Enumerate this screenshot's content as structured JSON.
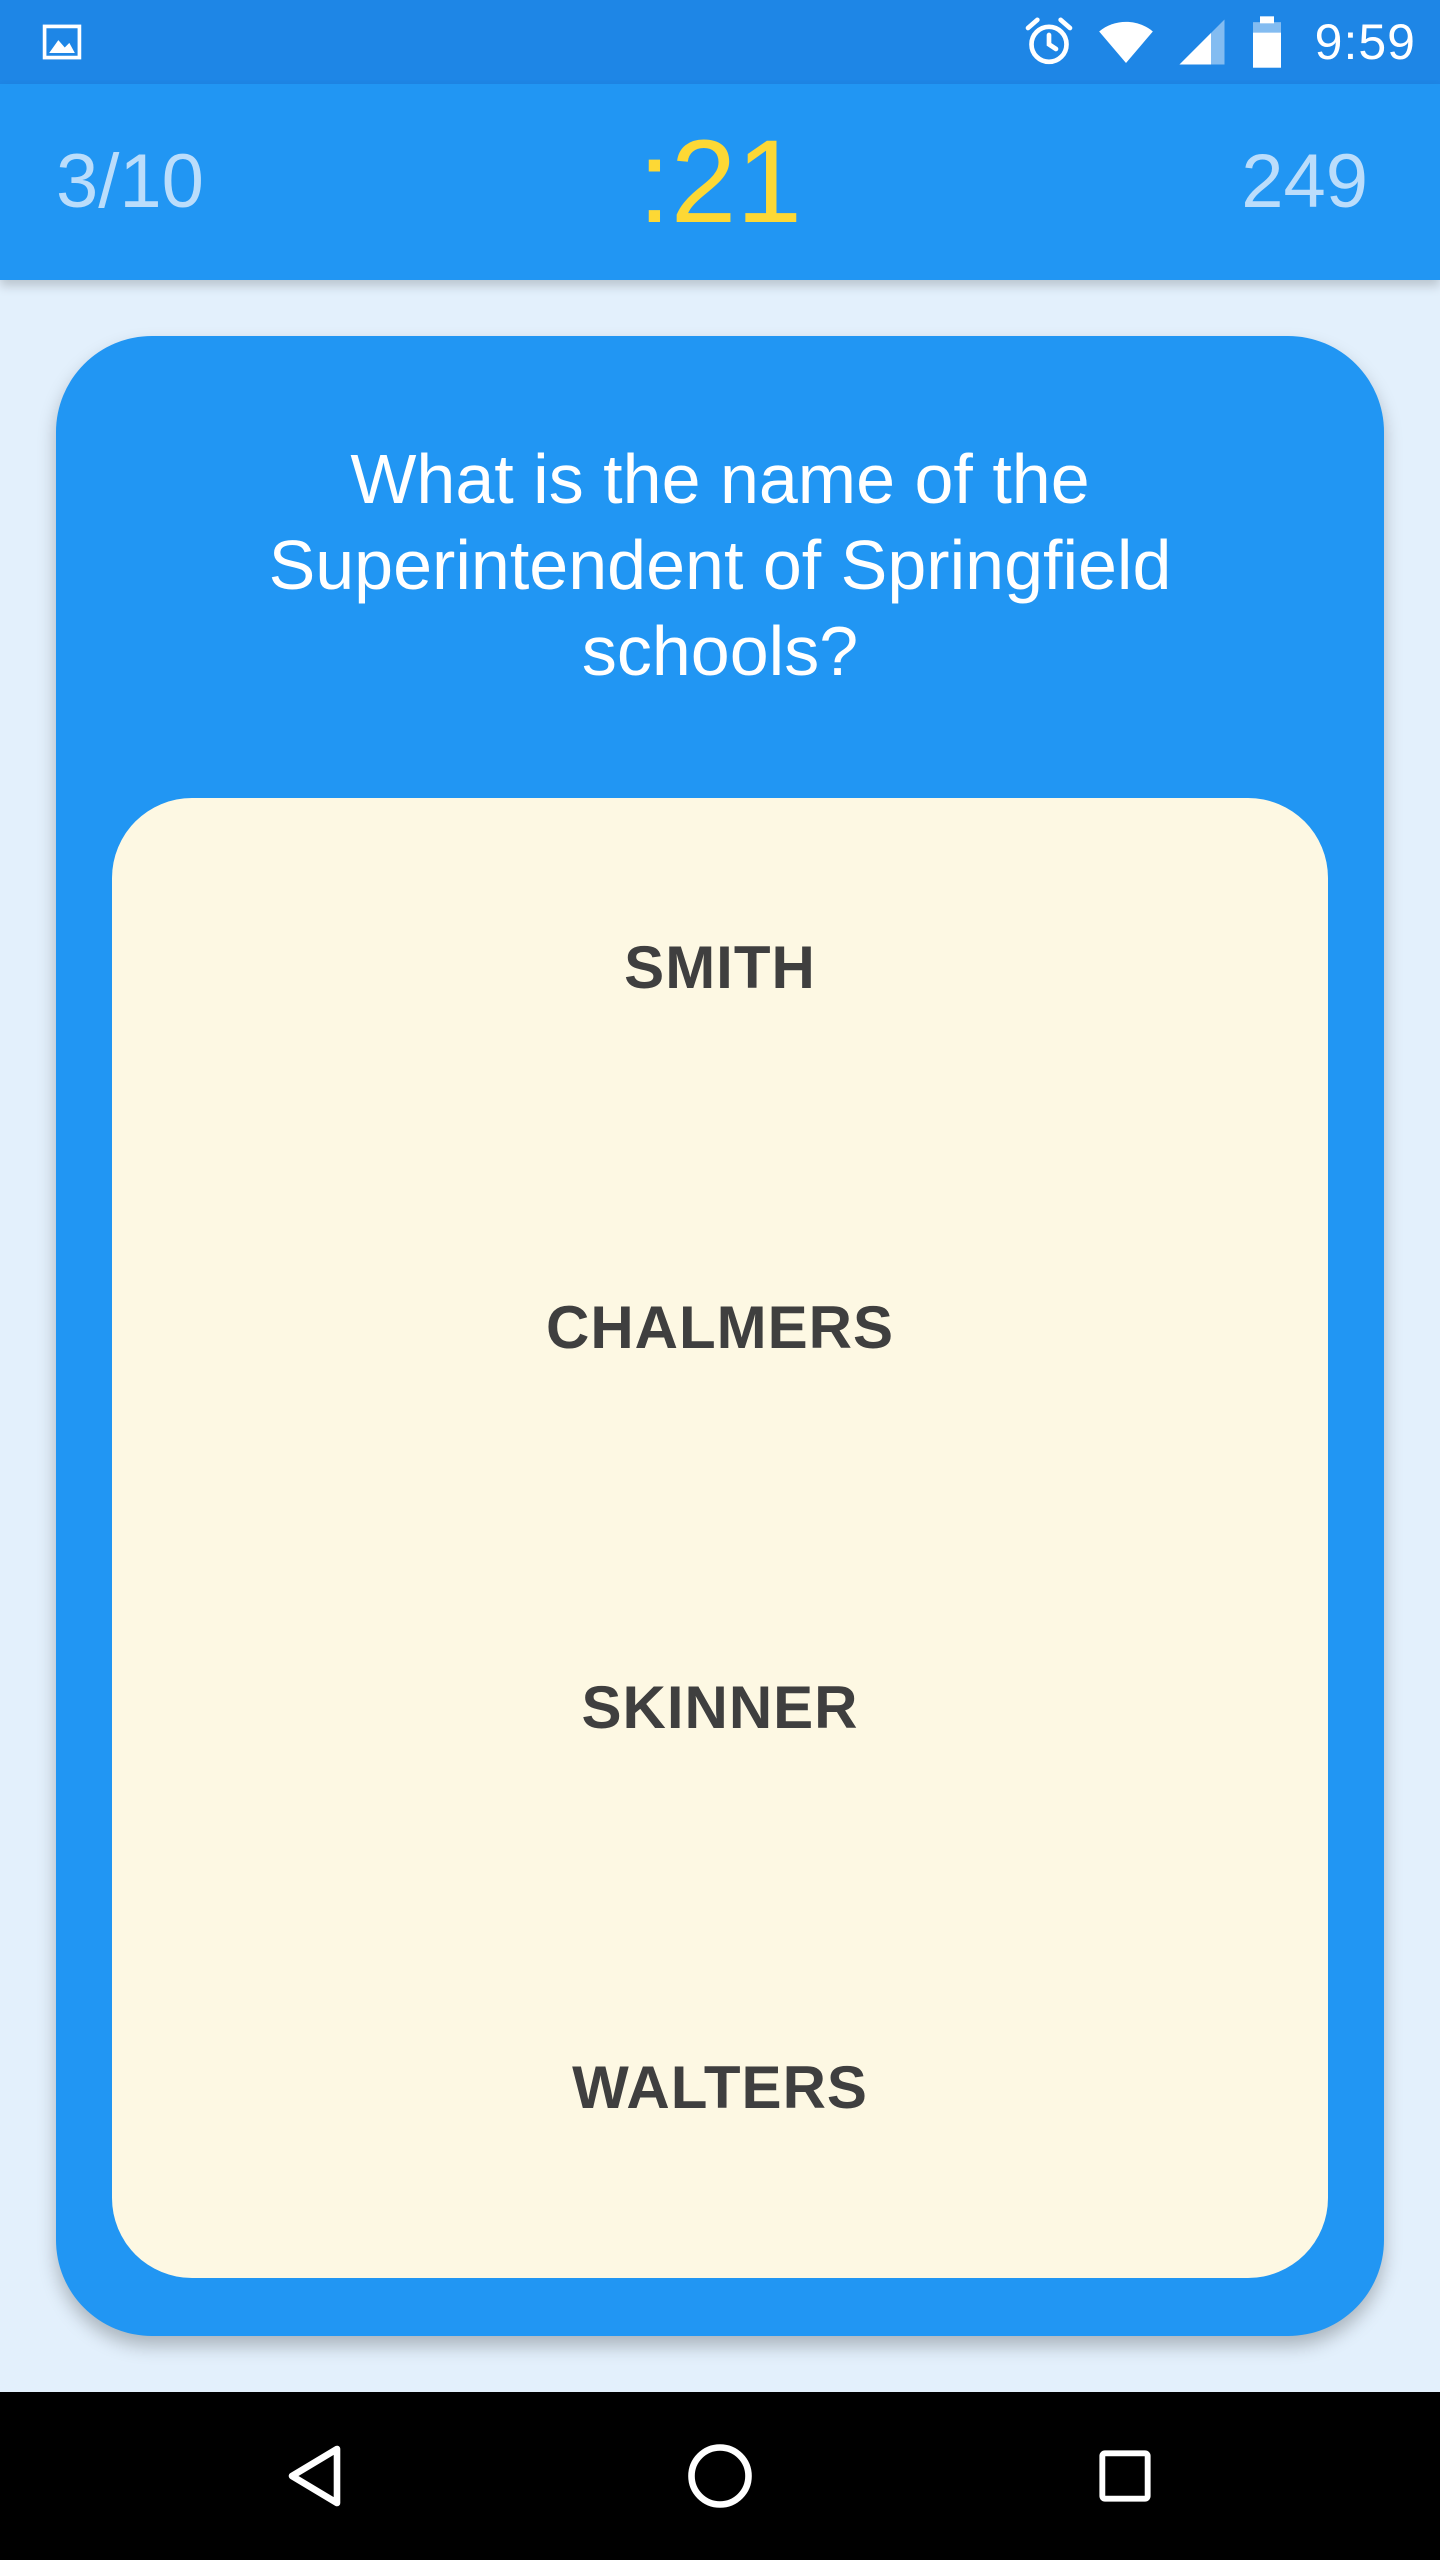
{
  "status_bar": {
    "time": "9:59",
    "icons": [
      "gallery-icon",
      "alarm-icon",
      "wifi-icon",
      "signal-icon",
      "battery-icon"
    ]
  },
  "app_bar": {
    "progress": "3/10",
    "timer": ":21",
    "score": "249"
  },
  "question": {
    "text": "What is the name of the Superintendent of Springfield schools?"
  },
  "answers": [
    {
      "label": "SMITH"
    },
    {
      "label": "CHALMERS"
    },
    {
      "label": "SKINNER"
    },
    {
      "label": "WALTERS"
    }
  ],
  "nav_bar": {
    "icons": [
      "back-icon",
      "home-icon",
      "recent-apps-icon"
    ]
  },
  "colors": {
    "status_bar": "#1E86E6",
    "app_bar": "#2196F3",
    "card": "#2196F3",
    "answers_panel": "#FDF8E3",
    "timer": "#FDD835",
    "page_background": "#E3F0FC"
  }
}
